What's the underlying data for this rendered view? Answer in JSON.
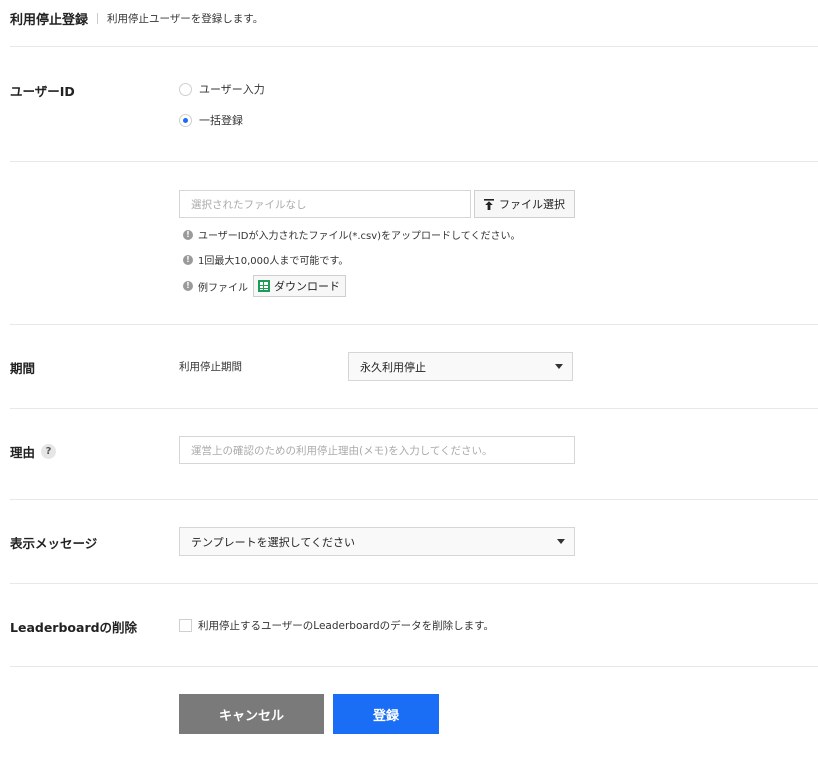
{
  "header": {
    "title": "利用停止登録",
    "description": "利用停止ユーザーを登録します。"
  },
  "user_id": {
    "label": "ユーザーID",
    "options": [
      {
        "label": "ユーザー入力",
        "selected": false
      },
      {
        "label": "一括登録",
        "selected": true
      }
    ]
  },
  "file_upload": {
    "placeholder": "選択されたファイルなし",
    "select_button": "ファイル選択",
    "notes": [
      "ユーザーIDが入力されたファイル(*.csv)をアップロードしてください。",
      "1回最大10,000人まで可能です。"
    ],
    "sample_label": "例ファイル",
    "download_button": "ダウンロード"
  },
  "period": {
    "label": "期間",
    "sublabel": "利用停止期間",
    "selected": "永久利用停止"
  },
  "reason": {
    "label": "理由",
    "help": "?",
    "placeholder": "運営上の確認のための利用停止理由(メモ)を入力してください。"
  },
  "display_message": {
    "label": "表示メッセージ",
    "selected": "テンプレートを選択してください"
  },
  "leaderboard": {
    "label": "Leaderboardの削除",
    "checkbox_label": "利用停止するユーザーのLeaderboardのデータを削除します。",
    "checked": false
  },
  "actions": {
    "cancel": "キャンセル",
    "submit": "登録"
  },
  "colors": {
    "primary": "#1a6ef5",
    "cancel_bg": "#7a7a7a",
    "sheet_icon": "#1f9b58"
  }
}
